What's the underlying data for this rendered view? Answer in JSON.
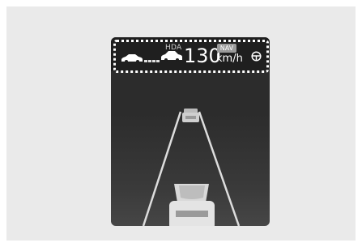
{
  "status": {
    "hda_label": "HDA",
    "speed": "130",
    "unit": "km/h",
    "nav_badge": "NAV"
  },
  "icons": {
    "car_left": "car-icon",
    "distance": "distance-dots-icon",
    "car_right": "car-icon",
    "steering": "steering-wheel-icon"
  },
  "colors": {
    "display_bg": "#2c2c2c",
    "text": "#ffffff",
    "badge": "#9a9a9a",
    "lane": "#dddddd"
  }
}
